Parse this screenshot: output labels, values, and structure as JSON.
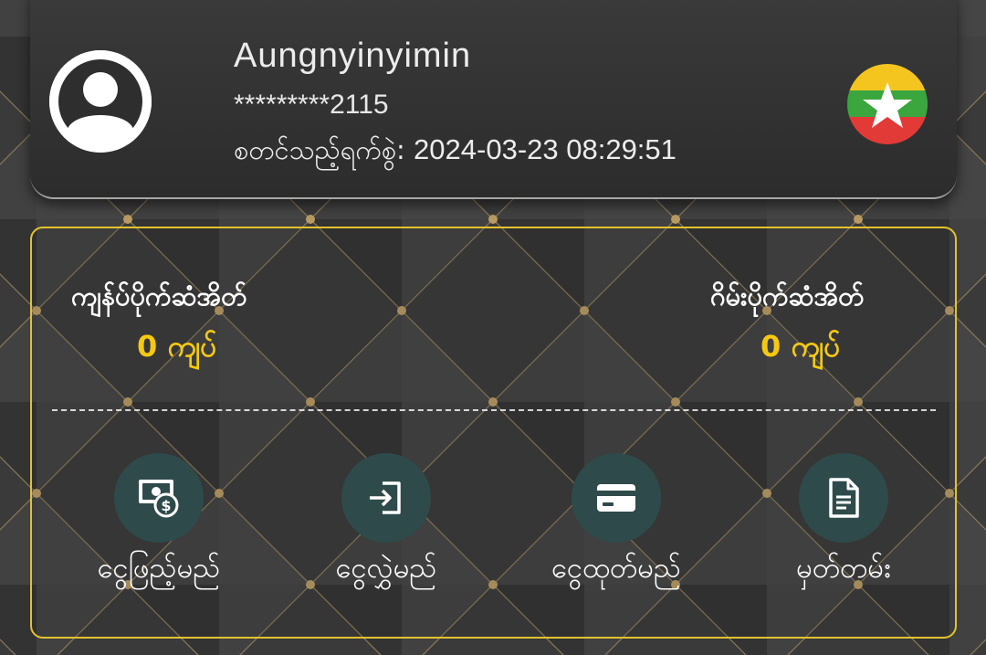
{
  "profile": {
    "username": "Aungnyinyimin",
    "masked_phone": "*********2115",
    "registered_label": "စတင်သည့်ရက်စွဲ: ",
    "registered_value": "2024-03-23 08:29:51"
  },
  "wallet": {
    "remaining_balance_label": "ကျန်ပ်ပိုက်ဆံအိတ်",
    "remaining_balance_value": "0 ကျပ်",
    "game_wallet_label": "ဂိမ်းပိုက်ဆံအိတ်",
    "game_wallet_value": "0 ကျပ်"
  },
  "actions": [
    {
      "label": "ငွေဖြည့်မည်",
      "icon": "deposit-money-icon"
    },
    {
      "label": "ငွေလွှဲမည်",
      "icon": "transfer-login-icon"
    },
    {
      "label": "ငွေထုတ်မည်",
      "icon": "card-icon"
    },
    {
      "label": "မှတ်တမ်း",
      "icon": "document-icon"
    }
  ],
  "colors": {
    "accent_gold": "#f6c90e",
    "card_border": "#e2c22e",
    "action_circle": "#2f4a4a",
    "background": "#3a3a3a"
  }
}
